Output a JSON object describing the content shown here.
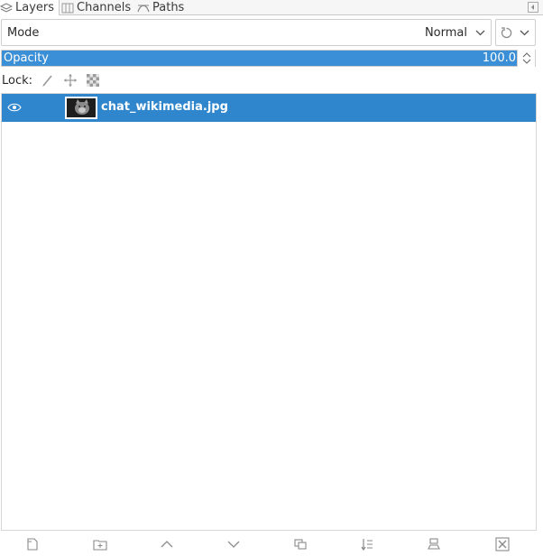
{
  "tabs": {
    "layers_label": "Layers",
    "channels_label": "Channels",
    "paths_label": "Paths"
  },
  "mode": {
    "label": "Mode",
    "value": "Normal"
  },
  "opacity": {
    "label": "Opacity",
    "value": "100.0",
    "level_percent": 100
  },
  "lock": {
    "label": "Lock:",
    "buttons": [
      "paint-lock-icon",
      "position-lock-icon",
      "alpha-lock-icon"
    ]
  },
  "layers": [
    {
      "name": "chat_wikimedia.jpg",
      "visible": true,
      "selected": true
    }
  ],
  "bottom_bar": {
    "buttons": [
      "new-layer-icon",
      "new-layer-group-icon",
      "raise-layer-icon",
      "lower-layer-icon",
      "duplicate-layer-icon",
      "merge-down-icon",
      "anchor-layer-icon",
      "delete-layer-icon"
    ]
  },
  "colors": {
    "accent": "#2f86cc",
    "opacity_fill": "#3b8fd6",
    "icon_gray": "#8a8a8a"
  }
}
